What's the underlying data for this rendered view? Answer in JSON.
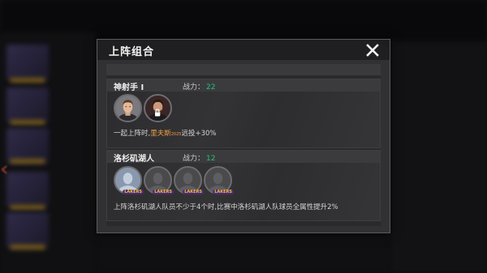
{
  "modal": {
    "title": "上阵组合",
    "close_icon": "close-icon"
  },
  "combos": [
    {
      "name": "神射手 I",
      "power_label": "战力：",
      "power_value": "22",
      "players": [
        {
          "type": "player-portrait",
          "locked": false
        },
        {
          "type": "player-portrait",
          "locked": true
        }
      ],
      "desc_prefix": "一起上阵时,",
      "desc_highlight": "里夫斯",
      "desc_tiny": "2025",
      "desc_suffix": "远投+30%"
    },
    {
      "name": "洛杉矶湖人",
      "power_label": "战力：",
      "power_value": "12",
      "players": [
        {
          "type": "silhouette",
          "team_badge": "LAKERS"
        },
        {
          "type": "silhouette",
          "team_badge": "LAKERS"
        },
        {
          "type": "silhouette",
          "team_badge": "LAKERS"
        },
        {
          "type": "silhouette",
          "team_badge": "LAKERS"
        }
      ],
      "desc": "上阵洛杉矶湖人队员不少于4个时,比赛中洛杉矶湖人队球员全属性提升2%"
    }
  ],
  "colors": {
    "power_green": "#27c07a",
    "highlight_orange": "#f0a040",
    "modal_bg": "#313133",
    "header_bg": "#1f1f21"
  }
}
